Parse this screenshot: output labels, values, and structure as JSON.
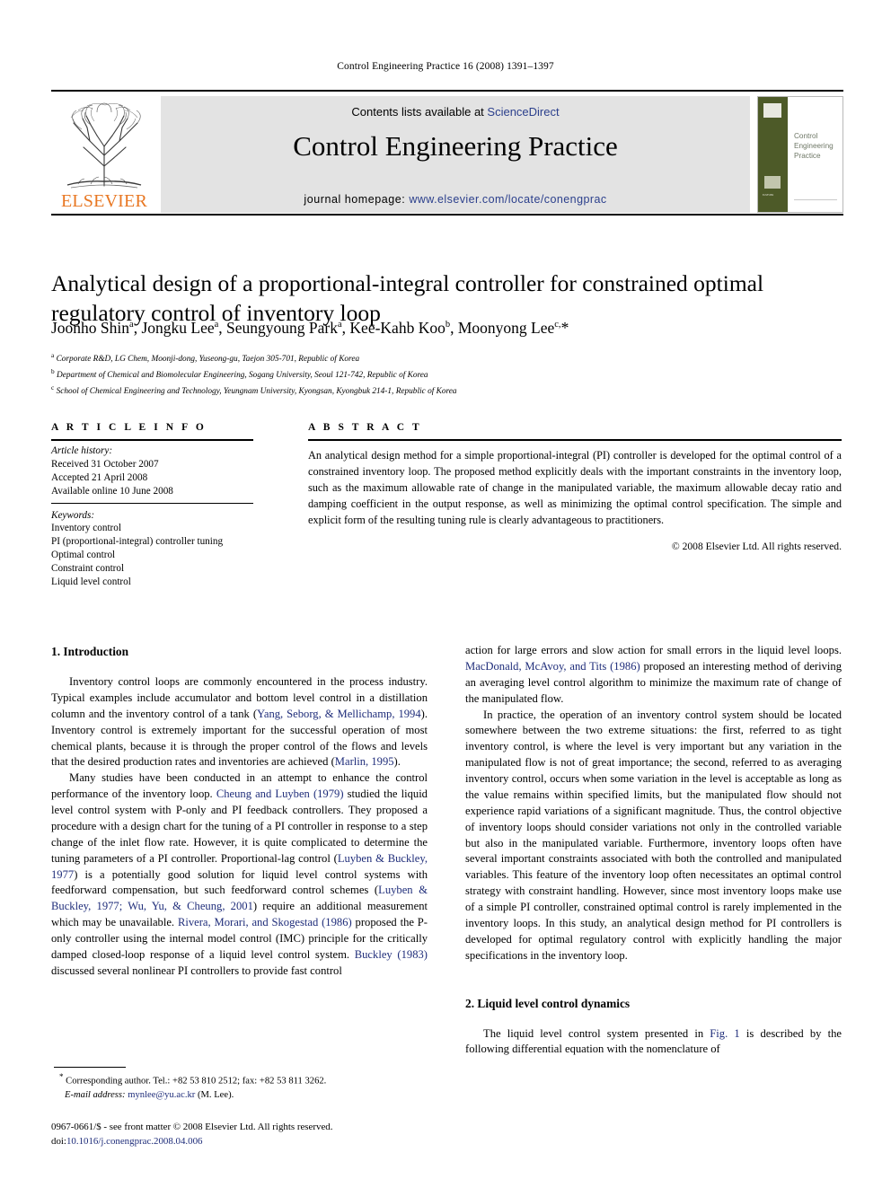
{
  "running_head": "Control Engineering Practice 16 (2008) 1391–1397",
  "masthead": {
    "publisher_name": "ELSEVIER",
    "contents_line_prefix": "Contents lists available at ",
    "sciencedirect": "ScienceDirect",
    "journal_title": "Control Engineering Practice",
    "homepage_prefix": "journal homepage: ",
    "homepage_url": "www.elsevier.com/locate/conengprac",
    "cover_title": "Control Engineering Practice",
    "colors": {
      "banner_bg": "#e3e3e3",
      "link_blue": "#2B3F8C",
      "elsevier_orange": "#E87722",
      "cover_green": "#4d5a28"
    }
  },
  "article": {
    "title": "Analytical design of a proportional-integral controller for constrained optimal regulatory control of inventory loop",
    "authors": "Joonho Shin<sup>a</sup>, Jongku Lee<sup>a</sup>, Seungyoung Park<sup>a</sup>, Kee-Kahb Koo<sup>b</sup>, Moonyong Lee<sup>c,</sup>*",
    "affiliations": [
      "<sup>a</sup> Corporate R&amp;D, LG Chem, Moonji-dong, Yuseong-gu, Taejon 305-701, Republic of Korea",
      "<sup>b</sup> Department of Chemical and Biomolecular Engineering, Sogang University, Seoul 121-742, Republic of Korea",
      "<sup>c</sup> School of Chemical Engineering and Technology, Yeungnam University, Kyongsan, Kyongbuk 214-1, Republic of Korea"
    ]
  },
  "article_info": {
    "heading": "A R T I C L E   I N F O",
    "history_label": "Article history:",
    "history": [
      "Received 31 October 2007",
      "Accepted 21 April 2008",
      "Available online 10 June 2008"
    ],
    "keywords_label": "Keywords:",
    "keywords": [
      "Inventory control",
      "PI (proportional-integral) controller tuning",
      "Optimal control",
      "Constraint control",
      "Liquid level control"
    ]
  },
  "abstract": {
    "heading": "A B S T R A C T",
    "text": "An analytical design method for a simple proportional-integral (PI) controller is developed for the optimal control of a constrained inventory loop. The proposed method explicitly deals with the important constraints in the inventory loop, such as the maximum allowable rate of change in the manipulated variable, the maximum allowable decay ratio and damping coefficient in the output response, as well as minimizing the optimal control specification. The simple and explicit form of the resulting tuning rule is clearly advantageous to practitioners.",
    "copyright": "© 2008 Elsevier Ltd. All rights reserved."
  },
  "body": {
    "section1_title": "1.  Introduction",
    "section2_title": "2.  Liquid level control dynamics",
    "p1_a": "Inventory control loops are commonly encountered in the process industry. Typical examples include accumulator and bottom level control in a distillation column and the inventory control of a tank (",
    "p1_ref1": "Yang, Seborg, & Mellichamp, 1994",
    "p1_b": "). Inventory control is extremely important for the successful operation of most chemical plants, because it is through the proper control of the flows and levels that the desired production rates and inventories are achieved (",
    "p1_ref2": "Marlin, 1995",
    "p1_c": ").",
    "p2_a": "Many studies have been conducted in an attempt to enhance the control performance of the inventory loop. ",
    "p2_ref1": "Cheung and Luyben (1979)",
    "p2_b": " studied the liquid level control system with P-only and PI feedback controllers. They proposed a procedure with a design chart for the tuning of a PI controller in response to a step change of the inlet flow rate. However, it is quite complicated to determine the tuning parameters of a PI controller. Proportional-lag control (",
    "p2_ref2": "Luyben & Buckley, 1977",
    "p2_c": ") is a potentially good solution for liquid level control systems with feedforward compensation, but such feedforward control schemes (",
    "p2_ref3": "Luyben & Buckley, 1977; Wu, Yu, & Cheung, 2001",
    "p2_d": ") require an additional measurement which may be unavailable. ",
    "p2_ref4": "Rivera, Morari, and Skogestad (1986)",
    "p2_e": " proposed the P-only controller using the internal model control (IMC) principle for the critically damped closed-loop response of a liquid level control system. ",
    "p2_ref5": "Buckley (1983)",
    "p2_f": " discussed several nonlinear PI controllers to provide fast control",
    "p3_a": "action for large errors and slow action for small errors in the liquid level loops. ",
    "p3_ref1": "MacDonald, McAvoy, and Tits (1986)",
    "p3_b": " proposed an interesting method of deriving an averaging level control algorithm to minimize the maximum rate of change of the manipulated flow.",
    "p4": "In practice, the operation of an inventory control system should be located somewhere between the two extreme situations: the first, referred to as tight inventory control, is where the level is very important but any variation in the manipulated flow is not of great importance; the second, referred to as averaging inventory control, occurs when some variation in the level is acceptable as long as the value remains within specified limits, but the manipulated flow should not experience rapid variations of a significant magnitude. Thus, the control objective of inventory loops should consider variations not only in the controlled variable but also in the manipulated variable. Furthermore, inventory loops often have several important constraints associated with both the controlled and manipulated variables. This feature of the inventory loop often necessitates an optimal control strategy with constraint handling. However, since most inventory loops make use of a simple PI controller, constrained optimal control is rarely implemented in the inventory loops. In this study, an analytical design method for PI controllers is developed for optimal regulatory control with explicitly handling the major specifications in the inventory loop.",
    "p5_a": "The liquid level control system presented in ",
    "p5_ref1": "Fig. 1",
    "p5_b": " is described by the following differential equation with the nomenclature of"
  },
  "footer": {
    "corresponding_marker": "*",
    "corresponding_text": "Corresponding author. Tel.: +82 53 810 2512; fax: +82 53 811 3262.",
    "email_label": "E-mail address:",
    "email": "mynlee@yu.ac.kr",
    "email_suffix": "(M. Lee).",
    "imprint": "0967-0661/$ - see front matter © 2008 Elsevier Ltd. All rights reserved.",
    "doi_label": "doi:",
    "doi": "10.1016/j.conengprac.2008.04.006"
  }
}
